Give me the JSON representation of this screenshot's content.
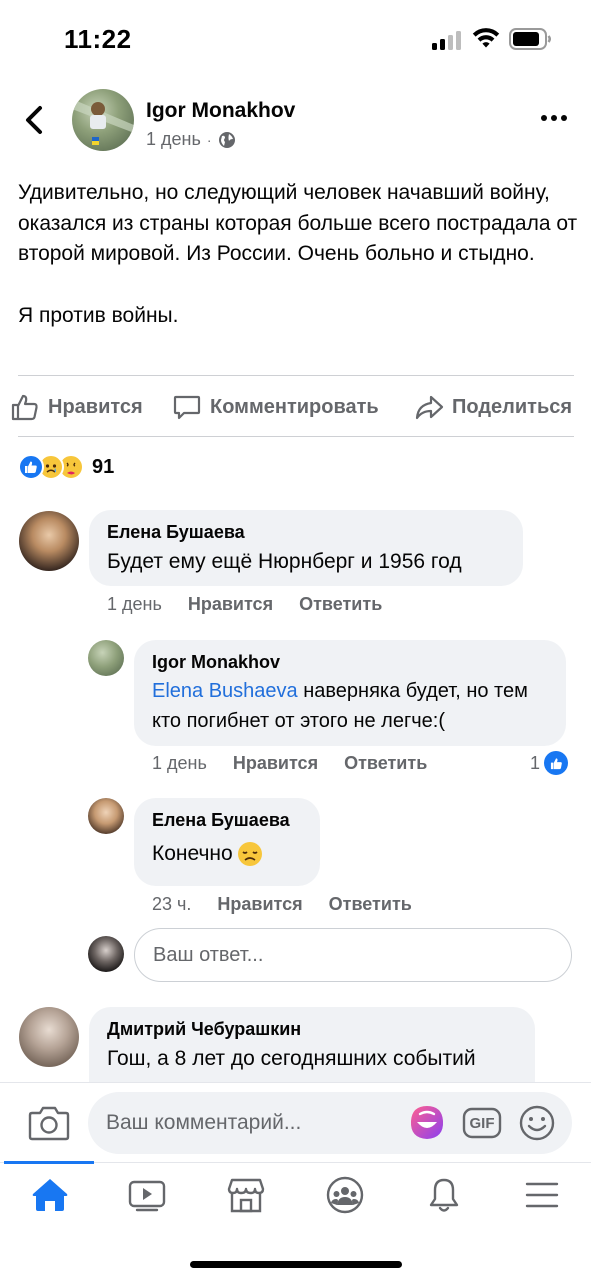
{
  "status_bar": {
    "time": "11:22"
  },
  "post": {
    "author": "Igor Monakhov",
    "meta": "1 день",
    "text": "Удивительно, но следующий человек начавший войну, оказался из страны которая больше всего пострадала от второй мировой. Из России. Очень больно и стыдно.",
    "text2": "Я против войны.",
    "reaction_count": "91"
  },
  "actions": {
    "like": "Нравится",
    "comment": "Комментировать",
    "share": "Поделиться"
  },
  "comments": [
    {
      "name": "Елена Бушаева",
      "text": "Будет ему ещё Нюрнберг и 1956 год",
      "time": "1 день",
      "like": "Нравится",
      "reply": "Ответить"
    },
    {
      "name": "Igor Monakhov",
      "mention": "Elena  Bushaeva",
      "text": " наверняка будет, но тем кто погибнет от этого не легче:(",
      "time": "1 день",
      "like": "Нравится",
      "reply": "Ответить",
      "likes": "1"
    },
    {
      "name": "Елена Бушаева",
      "text": "Конечно ",
      "time": "23 ч.",
      "like": "Нравится",
      "reply": "Ответить"
    },
    {
      "name": "Дмитрий Чебурашкин",
      "text": "Гош, а 8 лет до сегодняшних событий"
    }
  ],
  "reply_input": {
    "placeholder": "Ваш ответ..."
  },
  "comment_input": {
    "placeholder": "Ваш комментарий..."
  },
  "gif_label": "GIF",
  "colors": {
    "accent": "#1877f2",
    "secondary_text": "#65676b",
    "bubble": "#f0f2f5"
  },
  "icons": [
    "back-icon",
    "globe-icon",
    "more-icon",
    "like-icon",
    "comment-icon",
    "share-icon",
    "camera-icon",
    "avatar-sticker-icon",
    "gif-icon",
    "emoji-icon",
    "home-icon",
    "watch-icon",
    "marketplace-icon",
    "groups-icon",
    "notifications-icon",
    "menu-icon"
  ]
}
